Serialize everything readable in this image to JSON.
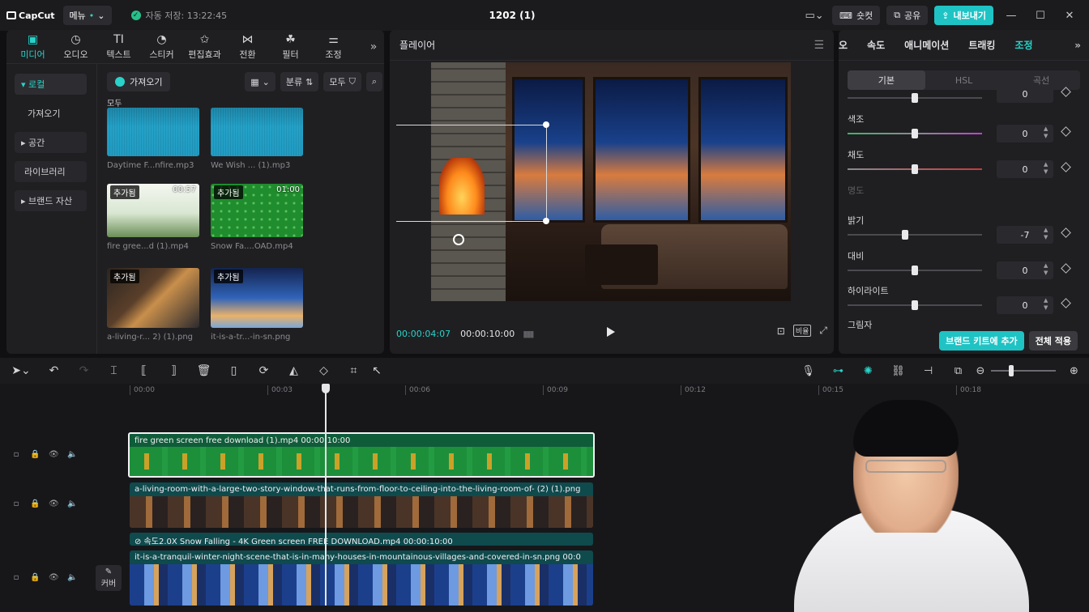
{
  "app": {
    "logo": "CapCut",
    "menu_label": "메뉴",
    "autosave": "자동 저장: 13:22:45",
    "project_title": "1202 (1)",
    "shortcut_label": "숏컷",
    "share_label": "공유",
    "export_label": "내보내기"
  },
  "left_tabs": [
    {
      "label": "미디어",
      "icon": "media-icon"
    },
    {
      "label": "오디오",
      "icon": "audio-icon"
    },
    {
      "label": "텍스트",
      "icon": "text-icon"
    },
    {
      "label": "스티커",
      "icon": "sticker-icon"
    },
    {
      "label": "편집효과",
      "icon": "effects-icon"
    },
    {
      "label": "전환",
      "icon": "transition-icon"
    },
    {
      "label": "필터",
      "icon": "filter-icon"
    },
    {
      "label": "조정",
      "icon": "adjust-icon"
    }
  ],
  "subnav": [
    "로컬",
    "가져오기",
    "공간",
    "라이브러리",
    "브랜드 자산"
  ],
  "media_toolbar": {
    "import_label": "가져오기",
    "sort_label": "분류",
    "filter_label": "모두"
  },
  "media_section": "모두",
  "media_items": [
    {
      "name": "Daytime F...nfire.mp3",
      "badge": "",
      "duration": ""
    },
    {
      "name": "We Wish ... (1).mp3",
      "badge": "",
      "duration": ""
    },
    {
      "name": "fire gree...d (1).mp4",
      "badge": "추가됨",
      "duration": "00:57"
    },
    {
      "name": "Snow Fa....OAD.mp4",
      "badge": "추가됨",
      "duration": "01:00"
    },
    {
      "name": "a-living-r... 2) (1).png",
      "badge": "추가됨",
      "duration": ""
    },
    {
      "name": "it-is-a-tr...-in-sn.png",
      "badge": "추가됨",
      "duration": ""
    }
  ],
  "player": {
    "title": "플레이어",
    "current_time": "00:00:04:07",
    "total_time": "00:00:10:00",
    "ratio_label": "비율"
  },
  "inspector": {
    "tabs": [
      "오",
      "속도",
      "애니메이션",
      "트래킹",
      "조정"
    ],
    "segments": [
      "기본",
      "HSL",
      "곡선"
    ],
    "adjustments": [
      {
        "label": "색조",
        "value": "0",
        "level": 0.5
      },
      {
        "label": "채도",
        "value": "0",
        "level": 0.5
      },
      {
        "label": "명도",
        "value": "",
        "level": null
      },
      {
        "label": "밝기",
        "value": "-7",
        "level": 0.43
      },
      {
        "label": "대비",
        "value": "0",
        "level": 0.5
      },
      {
        "label": "하이라이트",
        "value": "0",
        "level": 0.5
      },
      {
        "label": "그림자",
        "value": "",
        "level": null
      }
    ],
    "brand_kit_label": "브랜드 키트에 추가",
    "apply_all_label": "전체 적용"
  },
  "timeline": {
    "ruler": [
      "00:00",
      "00:03",
      "00:06",
      "00:09",
      "00:12",
      "00:15",
      "00:18"
    ],
    "clips": [
      {
        "title": "fire green screen free download (1).mp4  00:00:10:00"
      },
      {
        "title": "a-living-room-with-a-large-two-story-window-that-runs-from-floor-to-ceiling-into-the-living-room-of-  (2) (1).png"
      },
      {
        "title": "⊘ 속도2.0X  Snow Falling - 4K Green screen FREE DOWNLOAD.mp4  00:00:10:00"
      },
      {
        "title": "it-is-a-tranquil-winter-night-scene-that-is-in-many-houses-in-mountainous-villages-and-covered-in-sn.png  00:0"
      }
    ],
    "cover_label": "커버"
  }
}
